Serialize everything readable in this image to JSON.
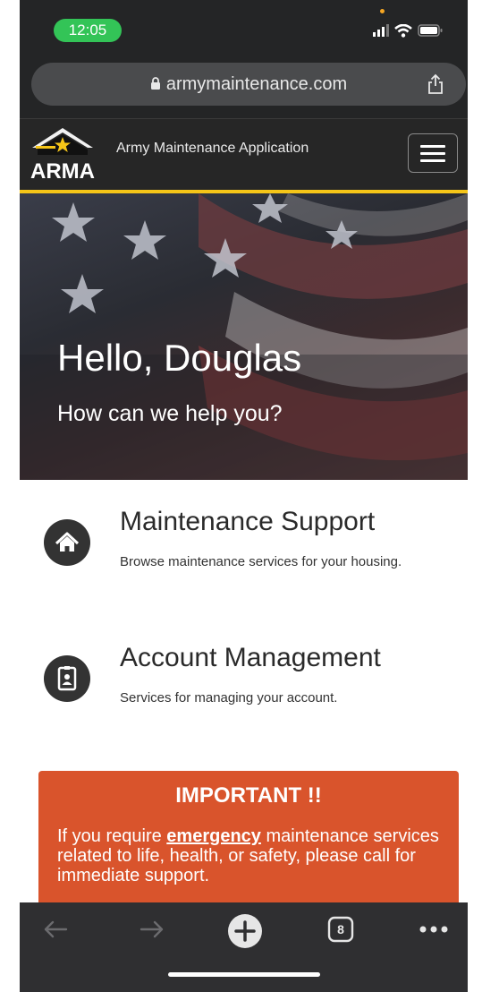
{
  "status_bar": {
    "time": "12:05"
  },
  "browser": {
    "url": "armymaintenance.com",
    "tab_count": "8"
  },
  "site": {
    "logo_text": "ARMA",
    "app_name": "Army Maintenance Application"
  },
  "hero": {
    "greeting": "Hello, Douglas",
    "subtitle": "How can we help you?"
  },
  "services": [
    {
      "title": "Maintenance Support",
      "description": "Browse maintenance services for your housing.",
      "icon": "home-icon"
    },
    {
      "title": "Account Management",
      "description": "Services for managing your account.",
      "icon": "id-badge-icon"
    }
  ],
  "important": {
    "title": "IMPORTANT !!",
    "text_before": "If you require ",
    "emphasis": "emergency",
    "text_after": " maintenance services related to life, health, or safety, please call for immediate support."
  },
  "colors": {
    "accent_gold": "#f5c518",
    "alert_orange": "#d9542c",
    "status_green": "#33c457"
  }
}
